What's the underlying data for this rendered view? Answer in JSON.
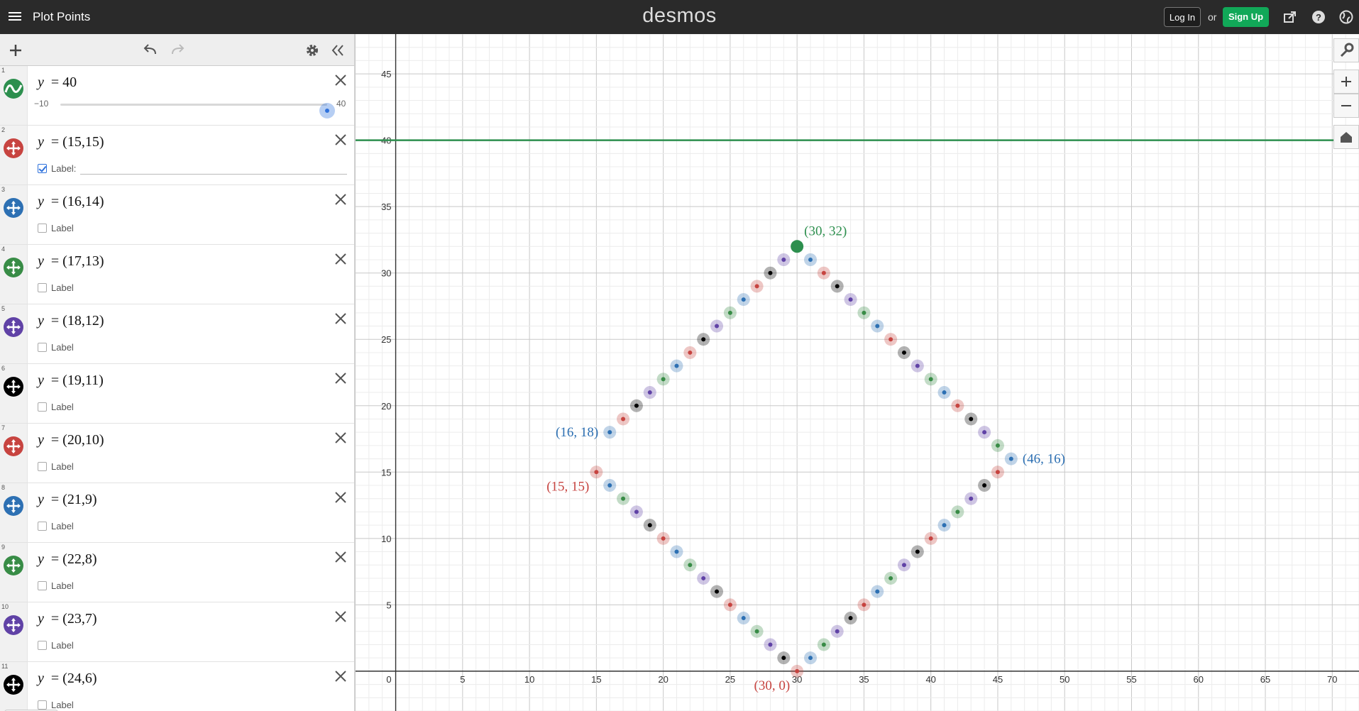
{
  "header": {
    "app_title": "Plot Points",
    "brand": "desmos",
    "login_label": "Log In",
    "or_label": "or",
    "signup_label": "Sign Up"
  },
  "expressions": [
    {
      "num": "1",
      "kind": "slider",
      "color": "#2d8f4e",
      "lhs": "y",
      "rhs": "40",
      "slider_min": "−10",
      "slider_max": "40",
      "slider_value": 40
    },
    {
      "num": "2",
      "kind": "point",
      "color": "#c74440",
      "lhs": "y",
      "rhs": "(15,15)",
      "label_checked": true,
      "label_text": "Label:"
    },
    {
      "num": "3",
      "kind": "point",
      "color": "#2d70b3",
      "lhs": "y",
      "rhs": "(16,14)",
      "label_checked": false,
      "label_text": "Label"
    },
    {
      "num": "4",
      "kind": "point",
      "color": "#388c46",
      "lhs": "y",
      "rhs": "(17,13)",
      "label_checked": false,
      "label_text": "Label"
    },
    {
      "num": "5",
      "kind": "point",
      "color": "#6042a6",
      "lhs": "y",
      "rhs": "(18,12)",
      "label_checked": false,
      "label_text": "Label"
    },
    {
      "num": "6",
      "kind": "point",
      "color": "#000000",
      "lhs": "y",
      "rhs": "(19,11)",
      "label_checked": false,
      "label_text": "Label"
    },
    {
      "num": "7",
      "kind": "point",
      "color": "#c74440",
      "lhs": "y",
      "rhs": "(20,10)",
      "label_checked": false,
      "label_text": "Label"
    },
    {
      "num": "8",
      "kind": "point",
      "color": "#2d70b3",
      "lhs": "y",
      "rhs": "(21,9)",
      "label_checked": false,
      "label_text": "Label"
    },
    {
      "num": "9",
      "kind": "point",
      "color": "#388c46",
      "lhs": "y",
      "rhs": "(22,8)",
      "label_checked": false,
      "label_text": "Label"
    },
    {
      "num": "10",
      "kind": "point",
      "color": "#6042a6",
      "lhs": "y",
      "rhs": "(23,7)",
      "label_checked": false,
      "label_text": "Label"
    },
    {
      "num": "11",
      "kind": "point",
      "color": "#000000",
      "lhs": "y",
      "rhs": "(24,6)",
      "label_checked": false,
      "label_text": "Label"
    }
  ],
  "colors": {
    "red": "#c74440",
    "blue": "#2d70b3",
    "green": "#388c46",
    "purple": "#6042a6",
    "black": "#000000",
    "line_green": "#2d8f4e"
  },
  "graph": {
    "x_range": [
      -3,
      72
    ],
    "y_range": [
      -3,
      48
    ],
    "x_ticks": [
      "5",
      "10",
      "15",
      "20",
      "25",
      "30",
      "35",
      "40",
      "45",
      "50",
      "55",
      "60",
      "65",
      "70"
    ],
    "y_ticks": [
      "5",
      "10",
      "15",
      "20",
      "25",
      "30",
      "35",
      "40",
      "45"
    ],
    "origin_label": "0",
    "horizontal_line_y": 40,
    "points": [
      [
        15,
        15,
        "red"
      ],
      [
        16,
        14,
        "blue"
      ],
      [
        17,
        13,
        "green"
      ],
      [
        18,
        12,
        "purple"
      ],
      [
        19,
        11,
        "black"
      ],
      [
        20,
        10,
        "red"
      ],
      [
        21,
        9,
        "blue"
      ],
      [
        22,
        8,
        "green"
      ],
      [
        23,
        7,
        "purple"
      ],
      [
        24,
        6,
        "black"
      ],
      [
        25,
        5,
        "red"
      ],
      [
        26,
        4,
        "blue"
      ],
      [
        27,
        3,
        "green"
      ],
      [
        28,
        2,
        "purple"
      ],
      [
        29,
        1,
        "black"
      ],
      [
        30,
        0,
        "red"
      ],
      [
        31,
        1,
        "blue"
      ],
      [
        32,
        2,
        "green"
      ],
      [
        33,
        3,
        "purple"
      ],
      [
        34,
        4,
        "black"
      ],
      [
        35,
        5,
        "red"
      ],
      [
        36,
        6,
        "blue"
      ],
      [
        37,
        7,
        "green"
      ],
      [
        38,
        8,
        "purple"
      ],
      [
        39,
        9,
        "black"
      ],
      [
        40,
        10,
        "red"
      ],
      [
        41,
        11,
        "blue"
      ],
      [
        42,
        12,
        "green"
      ],
      [
        43,
        13,
        "purple"
      ],
      [
        44,
        14,
        "black"
      ],
      [
        45,
        15,
        "red"
      ],
      [
        46,
        16,
        "blue"
      ],
      [
        45,
        17,
        "green"
      ],
      [
        44,
        18,
        "purple"
      ],
      [
        43,
        19,
        "black"
      ],
      [
        42,
        20,
        "red"
      ],
      [
        41,
        21,
        "blue"
      ],
      [
        40,
        22,
        "green"
      ],
      [
        39,
        23,
        "purple"
      ],
      [
        38,
        24,
        "black"
      ],
      [
        37,
        25,
        "red"
      ],
      [
        36,
        26,
        "blue"
      ],
      [
        35,
        27,
        "green"
      ],
      [
        34,
        28,
        "purple"
      ],
      [
        33,
        29,
        "black"
      ],
      [
        32,
        30,
        "red"
      ],
      [
        31,
        31,
        "blue"
      ],
      [
        29,
        31,
        "purple"
      ],
      [
        28,
        30,
        "black"
      ],
      [
        27,
        29,
        "red"
      ],
      [
        26,
        28,
        "blue"
      ],
      [
        25,
        27,
        "green"
      ],
      [
        24,
        26,
        "purple"
      ],
      [
        23,
        25,
        "black"
      ],
      [
        22,
        24,
        "red"
      ],
      [
        21,
        23,
        "blue"
      ],
      [
        20,
        22,
        "green"
      ],
      [
        19,
        21,
        "purple"
      ],
      [
        18,
        20,
        "black"
      ],
      [
        17,
        19,
        "red"
      ],
      [
        16,
        18,
        "blue"
      ]
    ],
    "highlight_point": [
      30,
      32,
      "line_green"
    ],
    "labels": [
      {
        "text": "(30, 32)",
        "x": 30,
        "y": 32,
        "color": "line_green",
        "anchor": "right-above"
      },
      {
        "text": "(16, 18)",
        "x": 16,
        "y": 18,
        "color": "blue",
        "anchor": "left"
      },
      {
        "text": "(15, 15)",
        "x": 15,
        "y": 15,
        "color": "red",
        "anchor": "left-below"
      },
      {
        "text": "(46, 16)",
        "x": 46,
        "y": 16,
        "color": "blue",
        "anchor": "right"
      },
      {
        "text": "(30, 0)",
        "x": 30,
        "y": 0,
        "color": "red",
        "anchor": "left-below"
      }
    ]
  }
}
